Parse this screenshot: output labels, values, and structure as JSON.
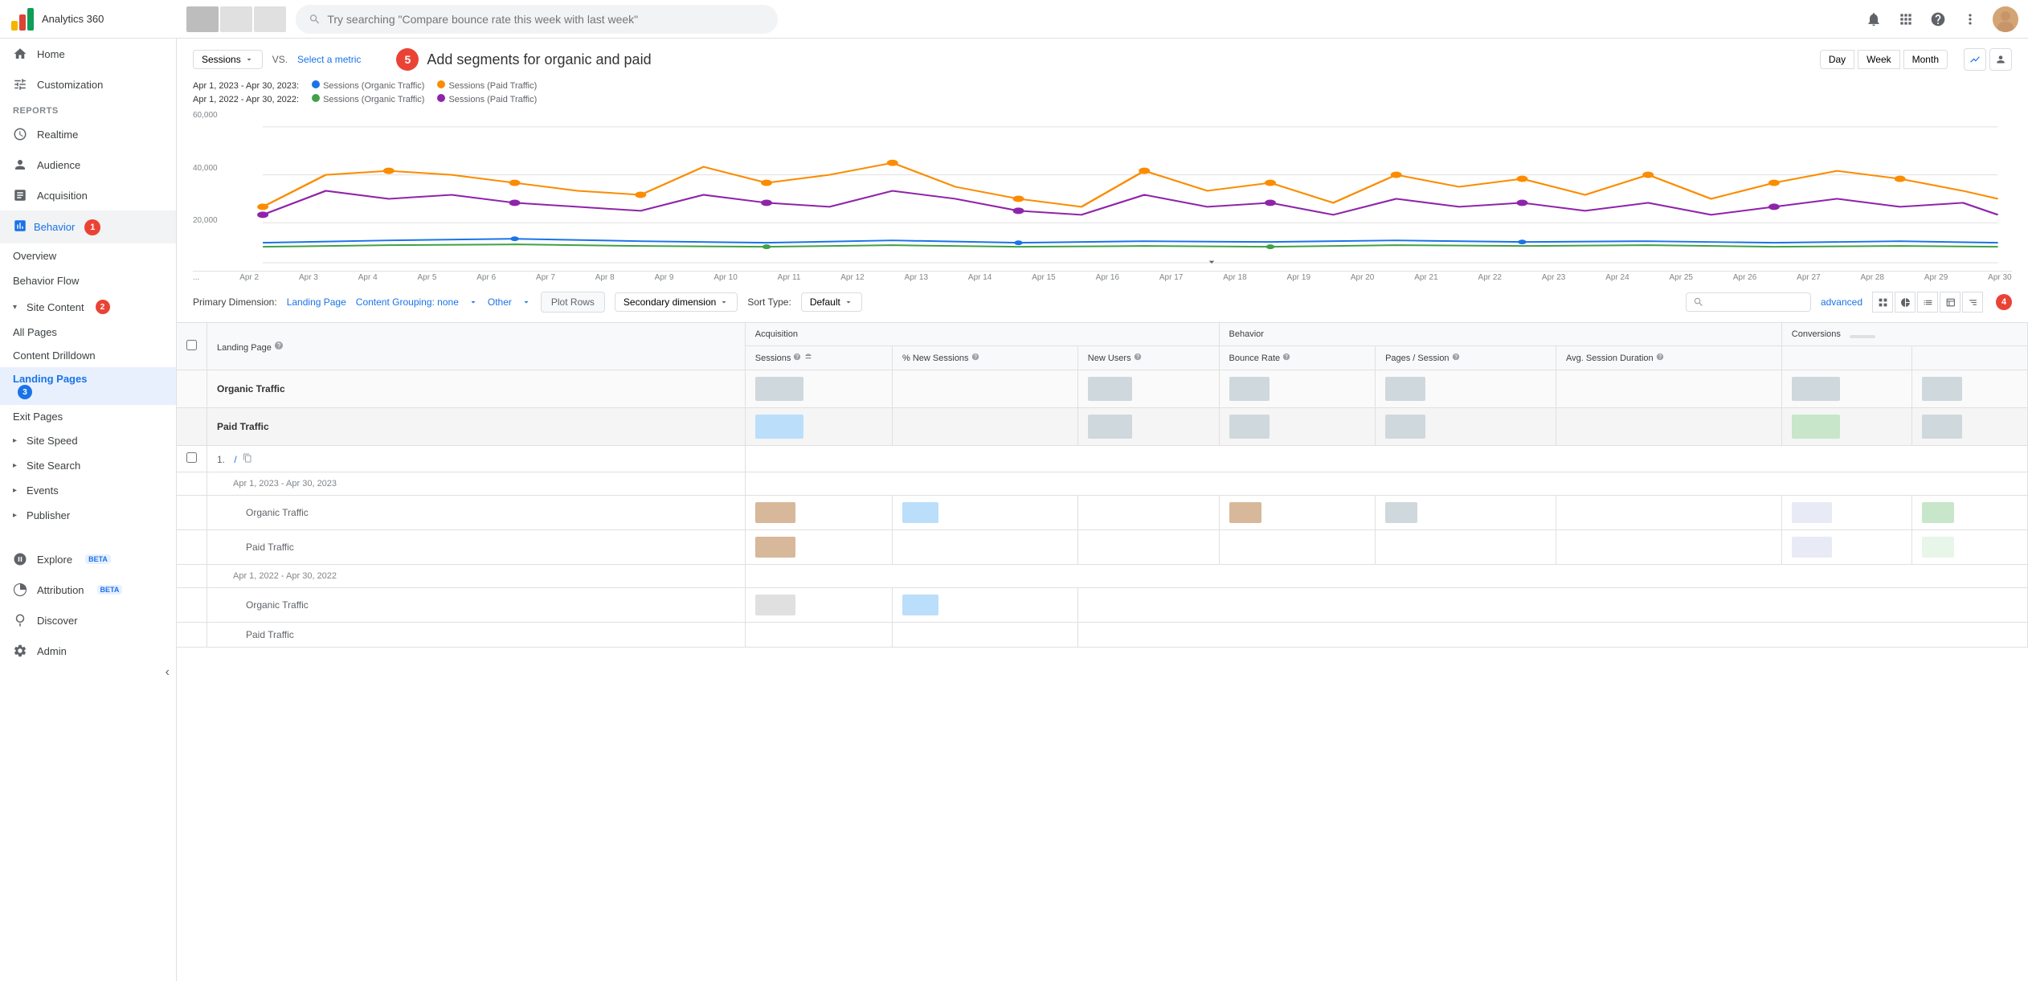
{
  "topbar": {
    "title": "Analytics 360",
    "search_placeholder": "Try searching \"Compare bounce rate this week with last week\"",
    "logo_colors": [
      "#F4B400",
      "#DB4437",
      "#0F9D58"
    ]
  },
  "sidebar": {
    "nav_items": [
      {
        "label": "Home",
        "icon": "home"
      },
      {
        "label": "Customization",
        "icon": "customize"
      }
    ],
    "reports_section": "REPORTS",
    "report_items": [
      {
        "label": "Realtime",
        "icon": "clock"
      },
      {
        "label": "Audience",
        "icon": "person"
      },
      {
        "label": "Acquisition",
        "icon": "arrow-up"
      },
      {
        "label": "Behavior",
        "icon": "bar-chart",
        "badge": "1",
        "active": true
      },
      {
        "label": "Overview",
        "sub": true
      },
      {
        "label": "Behavior Flow",
        "sub": true
      },
      {
        "label": "Site Content",
        "sub": true,
        "badge": "2",
        "expand": true
      },
      {
        "label": "All Pages",
        "subsub": true
      },
      {
        "label": "Content Drilldown",
        "subsub": true
      },
      {
        "label": "Landing Pages",
        "subsub": true,
        "active": true,
        "badge": "3"
      },
      {
        "label": "Exit Pages",
        "subsub": true
      },
      {
        "label": "Site Speed",
        "sub": true,
        "expand": true
      },
      {
        "label": "Site Search",
        "sub": true,
        "expand": true
      },
      {
        "label": "Events",
        "sub": true,
        "expand": true
      },
      {
        "label": "Publisher",
        "sub": true,
        "expand": true
      }
    ],
    "bottom_items": [
      {
        "label": "Explore",
        "icon": "compass",
        "badge": "BETA"
      },
      {
        "label": "Attribution",
        "icon": "pie",
        "badge": "BETA"
      },
      {
        "label": "Discover",
        "icon": "bulb"
      },
      {
        "label": "Admin",
        "icon": "gear"
      }
    ]
  },
  "chart": {
    "title": "Add segments for organic and paid",
    "step_num": "5",
    "date_range_1": "Apr 1, 2023 - Apr 30, 2023:",
    "date_range_2": "Apr 1, 2022 - Apr 30, 2022:",
    "legend": [
      {
        "color": "#1a73e8",
        "label": "Sessions (Organic Traffic)"
      },
      {
        "color": "#fb8c00",
        "label": "Sessions (Paid Traffic)"
      },
      {
        "color": "#43a047",
        "label": "Sessions (Organic Traffic)"
      },
      {
        "color": "#8e24aa",
        "label": "Sessions (Paid Traffic)"
      }
    ],
    "y_labels": [
      "60,000",
      "40,000",
      "20,000"
    ],
    "x_labels": [
      "...",
      "Apr 2",
      "Apr 3",
      "Apr 4",
      "Apr 5",
      "Apr 6",
      "Apr 7",
      "Apr 8",
      "Apr 9",
      "Apr 10",
      "Apr 11",
      "Apr 12",
      "Apr 13",
      "Apr 14",
      "Apr 15",
      "Apr 16",
      "Apr 17",
      "Apr 18",
      "Apr 19",
      "Apr 20",
      "Apr 21",
      "Apr 22",
      "Apr 23",
      "Apr 24",
      "Apr 25",
      "Apr 26",
      "Apr 27",
      "Apr 28",
      "Apr 29",
      "Apr 30"
    ],
    "time_buttons": [
      "Day",
      "Week",
      "Month"
    ],
    "segment_label": "Sessions",
    "vs_label": "VS.",
    "select_metric_label": "Select a metric"
  },
  "table": {
    "primary_dimension_label": "Primary Dimension:",
    "primary_dimension_value": "Landing Page",
    "content_grouping_label": "Content Grouping: none",
    "other_label": "Other",
    "plot_rows_label": "Plot Rows",
    "secondary_dimension_label": "Secondary dimension",
    "sort_type_label": "Sort Type:",
    "sort_type_value": "Default",
    "advanced_label": "advanced",
    "col_groups": [
      {
        "label": "Acquisition",
        "span": 3
      },
      {
        "label": "Behavior",
        "span": 3
      },
      {
        "label": "Conversions",
        "span": 2
      }
    ],
    "columns": [
      {
        "label": "Landing Page"
      },
      {
        "label": "Sessions",
        "sort": true
      },
      {
        "label": "% New Sessions"
      },
      {
        "label": "New Users"
      },
      {
        "label": "Bounce Rate"
      },
      {
        "label": "Pages / Session"
      },
      {
        "label": "Avg. Session Duration"
      },
      {
        "label": ""
      },
      {
        "label": ""
      }
    ],
    "segments": [
      {
        "label": "Organic Traffic"
      },
      {
        "label": "Paid Traffic"
      }
    ],
    "rows": [
      {
        "num": "1.",
        "page": "/",
        "sub_rows": [
          {
            "date": "Apr 1, 2023 - Apr 30, 2023",
            "traffic_rows": [
              {
                "label": "Organic Traffic",
                "color": "orange"
              },
              {
                "label": "Paid Traffic",
                "color": "blue"
              }
            ]
          },
          {
            "date": "Apr 1, 2022 - Apr 30, 2022",
            "traffic_rows": [
              {
                "label": "Organic Traffic",
                "color": "gray"
              },
              {
                "label": "Paid Traffic",
                "color": "light"
              }
            ]
          }
        ]
      }
    ]
  }
}
